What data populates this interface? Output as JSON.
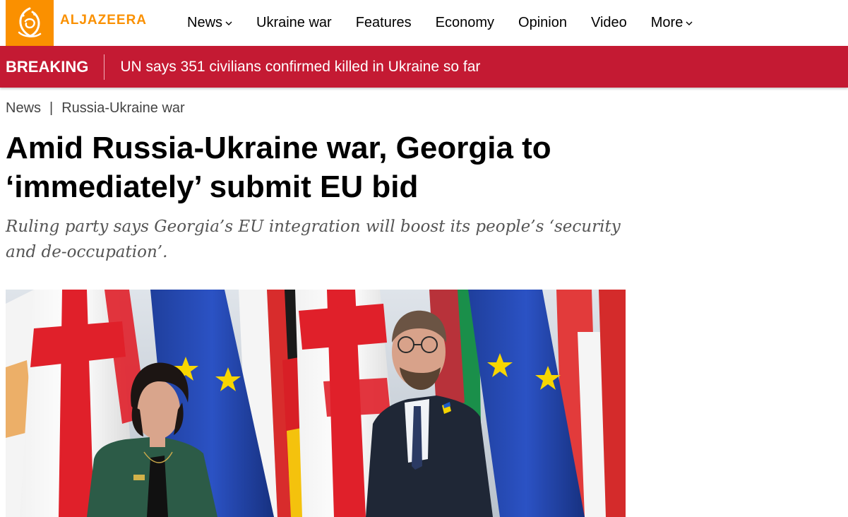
{
  "header": {
    "brand": "ALJAZEERA",
    "nav": [
      {
        "label": "News",
        "dropdown": true
      },
      {
        "label": "Ukraine war",
        "dropdown": false
      },
      {
        "label": "Features",
        "dropdown": false
      },
      {
        "label": "Economy",
        "dropdown": false
      },
      {
        "label": "Opinion",
        "dropdown": false
      },
      {
        "label": "Video",
        "dropdown": false
      },
      {
        "label": "More",
        "dropdown": true
      }
    ]
  },
  "breaking": {
    "label": "BREAKING",
    "text": "UN says 351 civilians confirmed killed in Ukraine so far"
  },
  "breadcrumb": [
    "News",
    "Russia-Ukraine war"
  ],
  "article": {
    "title": "Amid Russia-Ukraine war, Georgia to ‘immediately’ submit EU bid",
    "subtitle": "Ruling party says Georgia’s EU integration will boost its people’s ‘security and de-occupation’."
  },
  "colors": {
    "brand_orange": "#fa9000",
    "breaking_red": "#c41a33"
  }
}
